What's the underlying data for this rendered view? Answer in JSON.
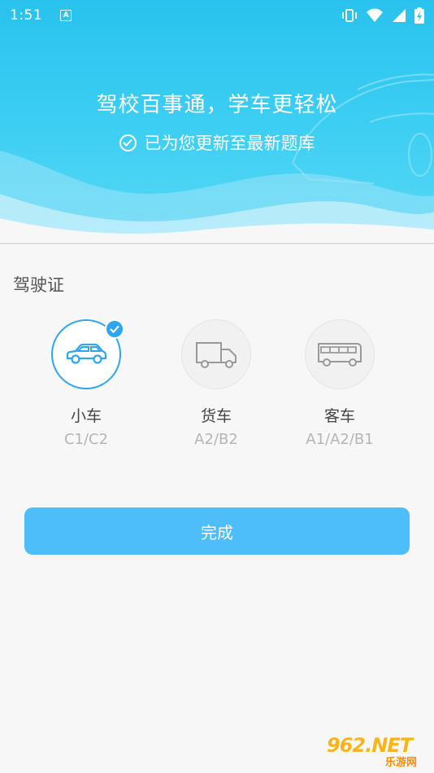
{
  "status_bar": {
    "time": "1:51",
    "notification_icon": "a-letter-icon",
    "icons": [
      "vibrate-icon",
      "wifi-icon",
      "signal-icon",
      "battery-charging-icon"
    ]
  },
  "header": {
    "headline": "驾校百事通，学车更轻松",
    "subline": "已为您更新至最新题库"
  },
  "section": {
    "title": "驾驶证"
  },
  "vehicles": [
    {
      "name": "小车",
      "code": "C1/C2",
      "icon": "car-icon",
      "selected": true
    },
    {
      "name": "货车",
      "code": "A2/B2",
      "icon": "truck-icon",
      "selected": false
    },
    {
      "name": "客车",
      "code": "A1/A2/B1",
      "icon": "bus-icon",
      "selected": false
    }
  ],
  "actions": {
    "done_label": "完成"
  },
  "watermark": {
    "main": "962.NET",
    "sub": "乐游网"
  },
  "colors": {
    "header_bg": "#35c8f1",
    "accent": "#2ea6ee",
    "button_bg": "#4dbefa"
  }
}
